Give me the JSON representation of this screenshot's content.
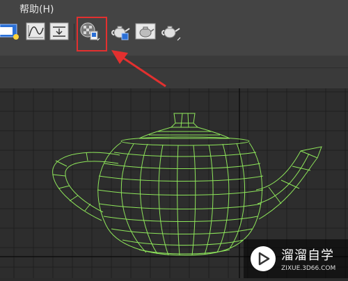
{
  "menubar": {
    "help_label": "帮助(H)"
  },
  "toolbar": {
    "buttons": [
      {
        "icon": "render-frame-window-icon",
        "active": true
      },
      {
        "icon": "curve-editor-icon"
      },
      {
        "icon": "dope-sheet-icon"
      },
      {
        "icon": "material-editor-icon",
        "highlighted": true
      },
      {
        "icon": "render-setup-icon"
      },
      {
        "icon": "rendered-frame-window-icon"
      },
      {
        "icon": "render-production-icon"
      }
    ]
  },
  "viewport": {
    "object": "teapot-wireframe",
    "wire_color": "#8ee65a",
    "grid_color": "#1f1f1f"
  },
  "annotation": {
    "color": "#e3302f"
  },
  "watermark": {
    "title": "溜溜自学",
    "url": "ZIXUE.3D66.COM"
  }
}
